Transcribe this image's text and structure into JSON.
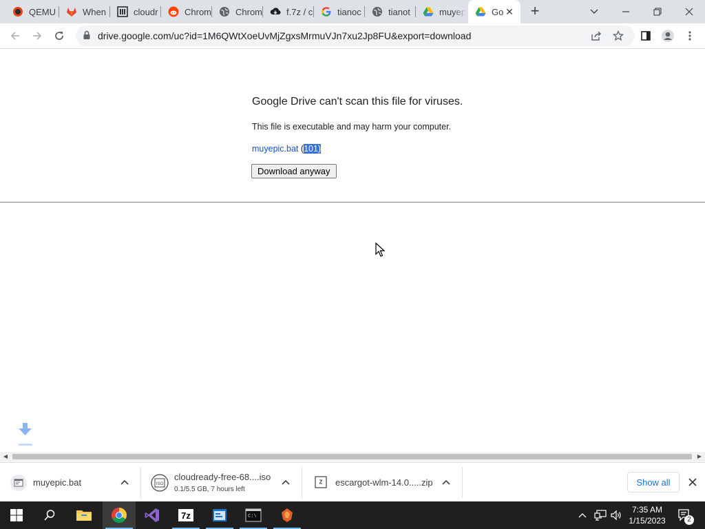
{
  "tabs": [
    {
      "title": "QEMU",
      "icon": "qemu-icon"
    },
    {
      "title": "When",
      "icon": "gitlab-icon"
    },
    {
      "title": "cloudr",
      "icon": "library-icon"
    },
    {
      "title": "Chrom",
      "icon": "reddit-icon"
    },
    {
      "title": "Chrom",
      "icon": "globe-icon"
    },
    {
      "title": "f.7z / c",
      "icon": "cloud-download-icon"
    },
    {
      "title": "tianoc",
      "icon": "google-icon"
    },
    {
      "title": "tianot",
      "icon": "globe-icon"
    },
    {
      "title": "muyep",
      "icon": "google-drive-icon"
    },
    {
      "title": "Go",
      "icon": "google-drive-icon",
      "active": true
    }
  ],
  "toolbar": {
    "url": "drive.google.com/uc?id=1M6QWtXoeUvMjZgxsMrmuVJn7xu2Jp8FU&export=download"
  },
  "page": {
    "title": "Google Drive can't scan this file for viruses.",
    "message": "This file is executable and may harm your computer.",
    "file_name": "muyepic.bat",
    "file_size_open": "(",
    "file_size": "101)",
    "download_button": "Download anyway"
  },
  "downloads": [
    {
      "name": "muyepic.bat",
      "status": "",
      "icon": "file-icon"
    },
    {
      "name": "cloudready-free-68....iso",
      "status": "0.1/5.5 GB, 7 hours left",
      "icon": "iso-file-icon"
    },
    {
      "name": "escargot-wlm-14.0.....zip",
      "status": "",
      "icon": "zip-file-icon"
    }
  ],
  "shelf": {
    "show_all": "Show all"
  },
  "taskbar": {
    "time": "7:35 AM",
    "date": "1/15/2023",
    "notification_count": "2"
  },
  "colors": {
    "link": "#1155cc",
    "selection": "#3372d6",
    "accent": "#1a73e8",
    "taskbar": "#1f1f1f"
  }
}
